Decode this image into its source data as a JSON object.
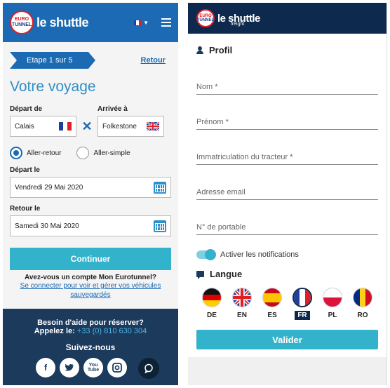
{
  "left": {
    "logo": {
      "line1": "EURO",
      "line2": "TUNNEL",
      "brand": "le shuttle"
    },
    "step_label": "Etape 1 sur 5",
    "back_label": "Retour",
    "title": "Votre voyage",
    "departure": {
      "label": "Départ de",
      "value": "Calais"
    },
    "arrival": {
      "label": "Arrivée à",
      "value": "Folkestone"
    },
    "trip_types": [
      {
        "label": "Aller-retour",
        "selected": true
      },
      {
        "label": "Aller-simple",
        "selected": false
      }
    ],
    "depart_date": {
      "label": "Départ le",
      "value": "Vendredi 29 Mai 2020"
    },
    "return_date": {
      "label": "Retour le",
      "value": "Samedi 30 Mai 2020"
    },
    "continue_label": "Continuer",
    "account_question": "Avez-vous un compte Mon Eurotunnel?",
    "account_link": "Se connecter pour voir et gérer vos véhicules sauvegardés",
    "footer": {
      "help_title": "Besoin d'aide pour réserver?",
      "call_label": "Appelez le:",
      "phone": "+33 (0) 810 630 304",
      "follow": "Suivez-nous",
      "socials": [
        "facebook-icon",
        "twitter-icon",
        "youtube-icon",
        "instagram-icon"
      ]
    },
    "colors": {
      "header": "#1b6ab3",
      "accent": "#33b2cc",
      "footer": "#1b3a5c"
    }
  },
  "right": {
    "logo": {
      "line1": "EURO",
      "line2": "TUNNEL",
      "brand": "le shuttle",
      "sub": "freight"
    },
    "profile_title": "Profil",
    "fields": [
      "Nom *",
      "Prénom *",
      "Immatriculation du tracteur *",
      "Adresse email",
      "N° de portable"
    ],
    "notifications_label": "Activer les notifications",
    "language_title": "Langue",
    "languages": [
      {
        "code": "DE",
        "selected": false
      },
      {
        "code": "EN",
        "selected": false
      },
      {
        "code": "ES",
        "selected": false
      },
      {
        "code": "FR",
        "selected": true
      },
      {
        "code": "PL",
        "selected": false
      },
      {
        "code": "RO",
        "selected": false
      }
    ],
    "submit_label": "Valider",
    "colors": {
      "header": "#0d2a4e",
      "accent": "#33b2cc"
    }
  }
}
